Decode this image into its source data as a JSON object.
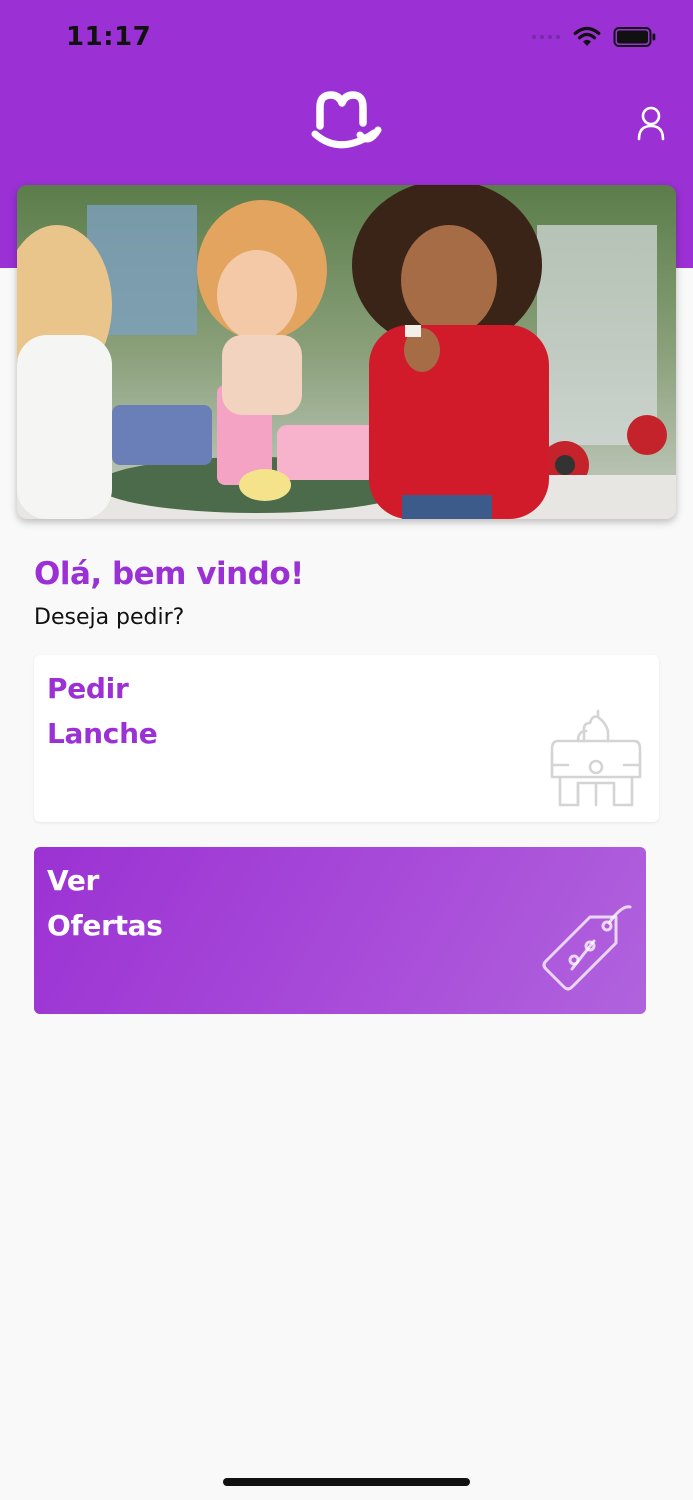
{
  "status_bar": {
    "time": "11:17",
    "icons": [
      "cellular-signal-icon",
      "wifi-icon",
      "battery-icon"
    ]
  },
  "header": {
    "logo": "m-smile-logo",
    "profile_icon": "user-icon"
  },
  "hero": {
    "image": "children eating lunch outdoors"
  },
  "greeting": {
    "title": "Olá, bem vindo!",
    "subtitle": "Deseja pedir?"
  },
  "cards": {
    "lanche": {
      "line1": "Pedir",
      "line2": "Lanche",
      "icon": "lunchbox-icon"
    },
    "ofertas": {
      "line1": "Ver",
      "line2": "Ofertas",
      "icon": "discount-tag-icon"
    }
  },
  "colors": {
    "brand": "#9b31d4",
    "background": "#f9f9f9",
    "card": "#ffffff"
  }
}
